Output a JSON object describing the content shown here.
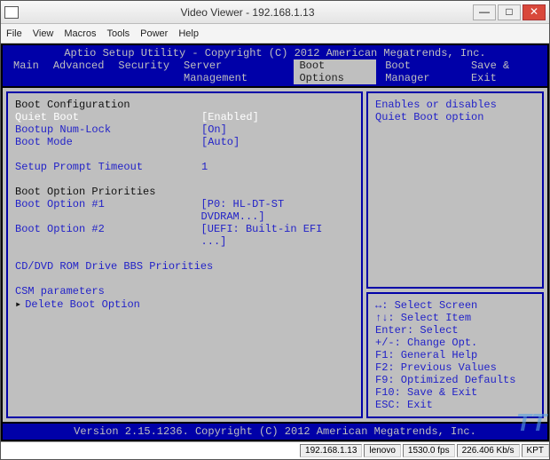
{
  "window": {
    "title": "Video Viewer - 192.168.1.13",
    "min": "—",
    "max": "□",
    "close": "✕"
  },
  "menu": {
    "items": [
      "File",
      "View",
      "Macros",
      "Tools",
      "Power",
      "Help"
    ]
  },
  "bios": {
    "header": "Aptio Setup Utility - Copyright (C) 2012 American Megatrends, Inc.",
    "tabs": [
      "Main",
      "Advanced",
      "Security",
      "Server Management",
      "Boot Options",
      "Boot Manager",
      "Save & Exit"
    ],
    "active_tab": "Boot Options",
    "left": {
      "section1": "Boot Configuration",
      "quiet_boot": {
        "label": "Quiet Boot",
        "value": "[Enabled]"
      },
      "numlock": {
        "label": "Bootup Num-Lock",
        "value": "[On]"
      },
      "boot_mode": {
        "label": "Boot Mode",
        "value": "[Auto]"
      },
      "timeout": {
        "label": "Setup Prompt Timeout",
        "value": "1"
      },
      "section2": "Boot Option Priorities",
      "opt1": {
        "label": "Boot Option #1",
        "value": "[P0: HL-DT-ST DVDRAM...]"
      },
      "opt2": {
        "label": "Boot Option #2",
        "value": "[UEFI: Built-in EFI ...]"
      },
      "bbs": "CD/DVD ROM Drive BBS Priorities",
      "csm": "CSM parameters",
      "del": "Delete Boot Option"
    },
    "right_help": "Enables or disables Quiet Boot option",
    "legend": [
      "↔: Select Screen",
      "↑↓: Select Item",
      "Enter: Select",
      "+/-: Change Opt.",
      "F1: General Help",
      "F2: Previous Values",
      "F9: Optimized Defaults",
      "F10: Save & Exit",
      "ESC: Exit"
    ],
    "footer": "Version 2.15.1236. Copyright (C) 2012 American Megatrends, Inc."
  },
  "status": {
    "ip": "192.168.1.13",
    "host": "lenovo",
    "fps": "1530.0 fps",
    "kbps": "226.406 Kb/s",
    "kpt": "KPT"
  },
  "watermark": "TT"
}
